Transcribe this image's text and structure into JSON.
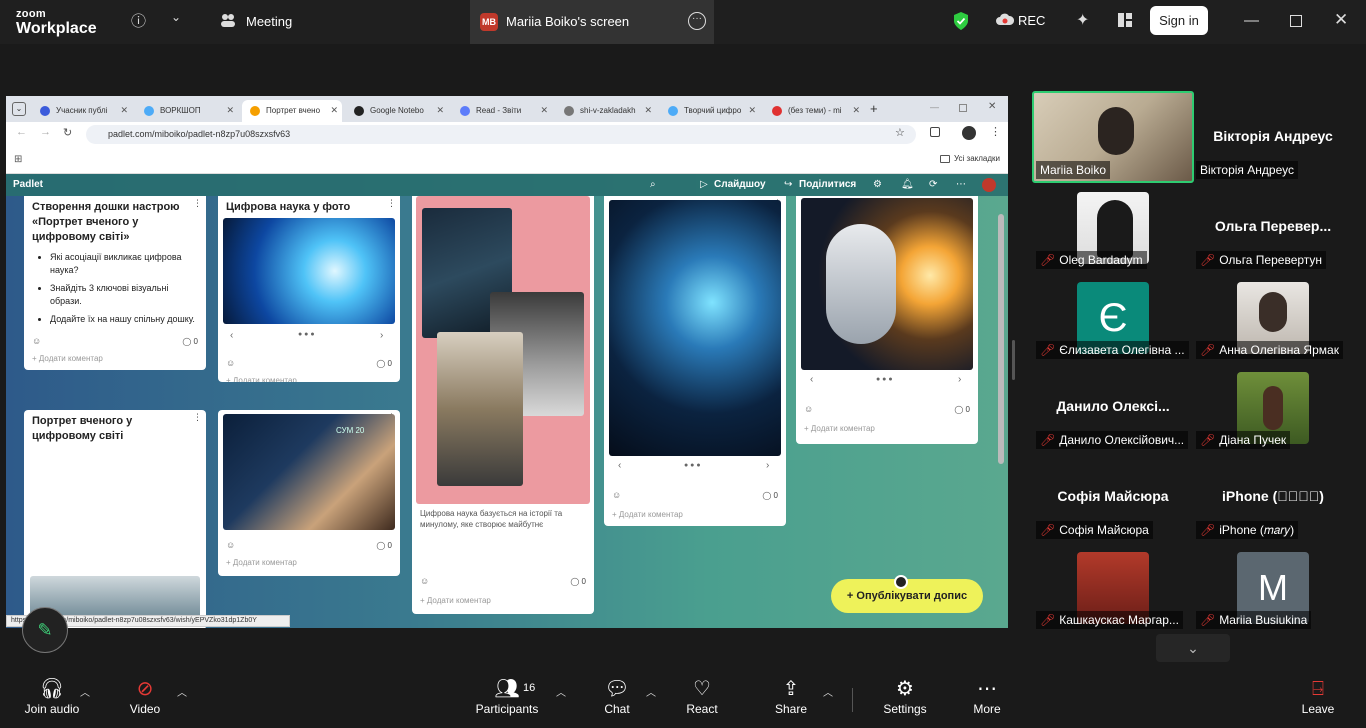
{
  "zoom": {
    "logo_top": "zoom",
    "logo_bottom": "Workplace",
    "meeting_label": "Meeting",
    "screen_badge": "MB",
    "screen_label": "Mariia Boiko's screen",
    "rec_label": "REC",
    "signin_label": "Sign in"
  },
  "browser": {
    "tabs": [
      {
        "label": "Учасник публі"
      },
      {
        "label": "ВОРКШОП"
      },
      {
        "label": "Портрет вчено"
      },
      {
        "label": "Google Notebo"
      },
      {
        "label": "Read - Звіти"
      },
      {
        "label": "shi-v-zakladakh"
      },
      {
        "label": "Творчий цифро"
      },
      {
        "label": "(без теми) - mi"
      }
    ],
    "url": "padlet.com/miboiko/padlet-n8zp7u08szxsfv63",
    "bookmarks_label": "Усі закладки",
    "status_url": "https://padlet.com/miboiko/padlet-n8zp7u08szxsfv63/wish/yEPVZko31dp1Zb0Y"
  },
  "padlet": {
    "brand": "Padlet",
    "slideshow": "Слайдшоу",
    "share": "Поділитися",
    "publish": "Опублікувати допис",
    "add_comment": "Додати коментар",
    "cards": {
      "c1": {
        "title": "Створення дошки настрою «Портрет вченого у цифровому світі»",
        "bullets": [
          "Які асоціації викликає цифрова наука?",
          "Знайдіть 3 ключові візуальні образи.",
          "Додайте їх на нашу спільну дошку."
        ],
        "count": "0"
      },
      "c2": {
        "title": "Цифрова наука у фото",
        "count": "0"
      },
      "c3": {
        "title": "Портрет вченого у цифровому світі"
      },
      "c4": {
        "count": "0",
        "screen_text": "СУМ 20"
      },
      "c5": {
        "caption": "Цифрова наука базується на історії та минулому, яке створює майбутнє",
        "count": "0"
      },
      "c6": {
        "count": "0"
      },
      "c7": {
        "count": "0"
      }
    }
  },
  "participants": [
    {
      "big": "",
      "label": "Mariia Boiko",
      "muted": false
    },
    {
      "big": "Вікторія Андреус",
      "label": "Вікторія Андреус",
      "muted": false
    },
    {
      "big": "",
      "label": "Oleg Bardadym",
      "muted": true
    },
    {
      "big": "Ольга Перевер...",
      "label": "Ольга Перевертун",
      "muted": true
    },
    {
      "big": "",
      "label": "Єлизавета Олегівна ...",
      "muted": true,
      "avatar": "Є"
    },
    {
      "big": "",
      "label": "Анна Олегівна Ярмак",
      "muted": true
    },
    {
      "big": "Данило Олексі...",
      "label": "Данило Олексійович...",
      "muted": true
    },
    {
      "big": "",
      "label": "Діана Пучек",
      "muted": true
    },
    {
      "big": "Софія Майсюра",
      "label": "Софія Майсюра",
      "muted": true
    },
    {
      "big": "iPhone (􀀀􀀀􀀀􀀀)",
      "label": "iPhone (𝑚𝑎𝑟𝑦)",
      "muted": true
    },
    {
      "big": "",
      "label": "Кашкаускас Маргар...",
      "muted": true
    },
    {
      "big": "",
      "label": "Mariia Busiukina",
      "muted": true,
      "avatar": "M"
    }
  ],
  "bottom": {
    "join_audio": "Join audio",
    "video": "Video",
    "participants": "Participants",
    "participants_count": "16",
    "chat": "Chat",
    "react": "React",
    "share": "Share",
    "settings": "Settings",
    "more": "More",
    "leave": "Leave"
  }
}
